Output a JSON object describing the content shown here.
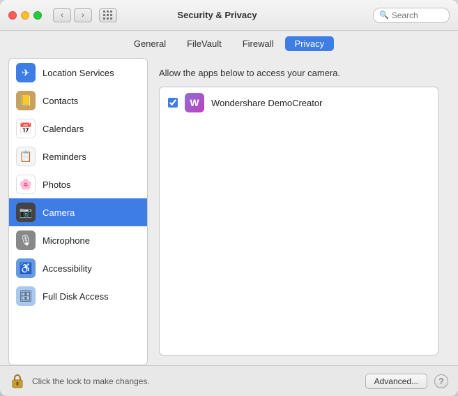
{
  "window": {
    "title": "Security & Privacy"
  },
  "titlebar": {
    "search_placeholder": "Search"
  },
  "tabs": [
    {
      "id": "general",
      "label": "General",
      "active": false
    },
    {
      "id": "filevault",
      "label": "FileVault",
      "active": false
    },
    {
      "id": "firewall",
      "label": "Firewall",
      "active": false
    },
    {
      "id": "privacy",
      "label": "Privacy",
      "active": true
    }
  ],
  "sidebar": {
    "items": [
      {
        "id": "location-services",
        "label": "Location Services",
        "icon": "📍",
        "iconBg": "#3d7de5",
        "active": false
      },
      {
        "id": "contacts",
        "label": "Contacts",
        "icon": "📒",
        "iconBg": "#c8a060",
        "active": false
      },
      {
        "id": "calendars",
        "label": "Calendars",
        "icon": "📅",
        "iconBg": "#e05050",
        "active": false
      },
      {
        "id": "reminders",
        "label": "Reminders",
        "icon": "📋",
        "iconBg": "#f5f5f5",
        "active": false
      },
      {
        "id": "photos",
        "label": "Photos",
        "icon": "🌸",
        "iconBg": "#ffffff",
        "active": false
      },
      {
        "id": "camera",
        "label": "Camera",
        "icon": "📷",
        "iconBg": "#444444",
        "active": true
      },
      {
        "id": "microphone",
        "label": "Microphone",
        "icon": "🎙️",
        "iconBg": "#888888",
        "active": false
      },
      {
        "id": "accessibility",
        "label": "Accessibility",
        "icon": "♿",
        "iconBg": "#6699dd",
        "active": false
      },
      {
        "id": "full-disk-access",
        "label": "Full Disk Access",
        "icon": "💾",
        "iconBg": "#a8c8f0",
        "active": false
      }
    ]
  },
  "content": {
    "description": "Allow the apps below to access your camera.",
    "apps": [
      {
        "id": "wondershare",
        "name": "Wondershare DemoCreator",
        "checked": true
      }
    ]
  },
  "bottombar": {
    "lock_text": "Click the lock to make changes.",
    "advanced_label": "Advanced...",
    "help_label": "?"
  }
}
